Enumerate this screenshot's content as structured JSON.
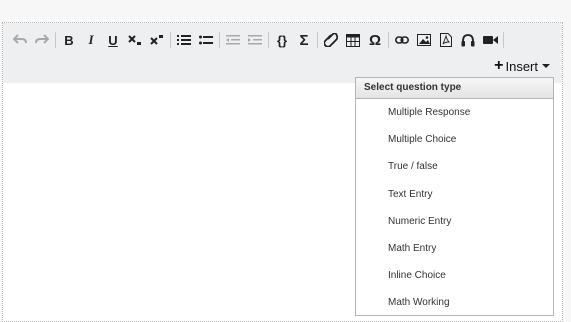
{
  "toolbar": {
    "buttons": [
      {
        "name": "undo-icon",
        "disabled": true
      },
      {
        "name": "redo-icon",
        "disabled": true
      },
      {
        "name": "bold-icon",
        "disabled": false
      },
      {
        "name": "italic-icon",
        "disabled": false
      },
      {
        "name": "underline-icon",
        "disabled": false
      },
      {
        "name": "subscript-icon",
        "disabled": false
      },
      {
        "name": "superscript-icon",
        "disabled": false
      },
      {
        "name": "numbered-list-icon",
        "disabled": false
      },
      {
        "name": "bulleted-list-icon",
        "disabled": false
      },
      {
        "name": "outdent-icon",
        "disabled": true
      },
      {
        "name": "indent-icon",
        "disabled": true
      },
      {
        "name": "code-braces-icon",
        "disabled": false
      },
      {
        "name": "sigma-icon",
        "disabled": false
      },
      {
        "name": "attachment-icon",
        "disabled": false
      },
      {
        "name": "table-icon",
        "disabled": false
      },
      {
        "name": "omega-icon",
        "disabled": false
      },
      {
        "name": "link-icon",
        "disabled": false
      },
      {
        "name": "image-icon",
        "disabled": false
      },
      {
        "name": "pdf-icon",
        "disabled": false
      },
      {
        "name": "headphones-icon",
        "disabled": false
      },
      {
        "name": "video-icon",
        "disabled": false
      }
    ],
    "text_icons": {
      "bold": "B",
      "italic": "I",
      "underline": "U",
      "code": "{}",
      "sigma": "Σ",
      "omega": "Ω"
    }
  },
  "insert": {
    "label": "Insert"
  },
  "question_menu": {
    "header": "Select question type",
    "items": [
      "Multiple Response",
      "Multiple Choice",
      "True / false",
      "Text Entry",
      "Numeric Entry",
      "Math Entry",
      "Inline Choice",
      "Math Working"
    ]
  }
}
